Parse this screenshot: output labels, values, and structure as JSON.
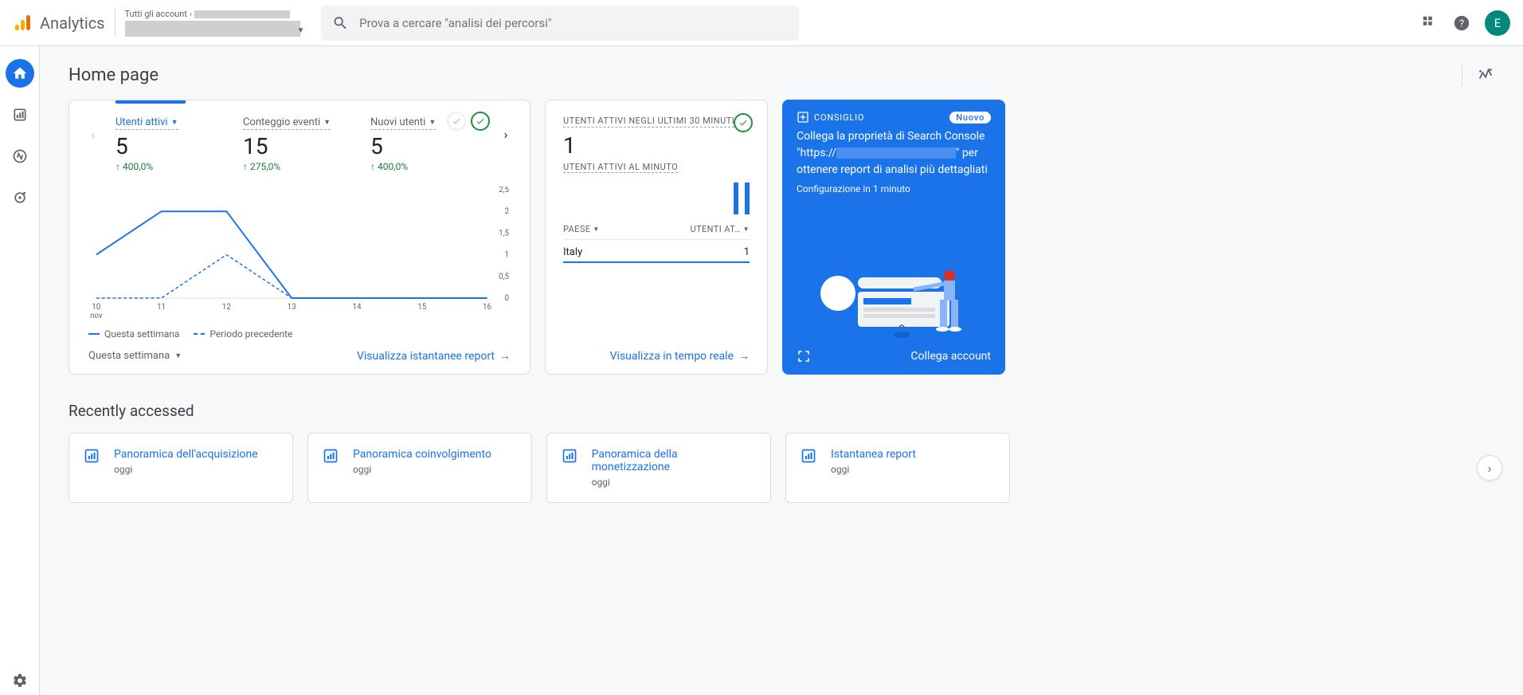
{
  "app": {
    "name": "Analytics"
  },
  "account": {
    "breadcrumb": "Tutti gli account"
  },
  "search": {
    "placeholder": "Prova a cercare \"analisi dei percorsi\""
  },
  "avatar": {
    "initial": "E"
  },
  "page": {
    "title": "Home page"
  },
  "metrics": [
    {
      "label": "Utenti attivi",
      "value": "5",
      "delta": "↑ 400,0%"
    },
    {
      "label": "Conteggio eventi",
      "value": "15",
      "delta": "↑ 275,0%"
    },
    {
      "label": "Nuovi utenti",
      "value": "5",
      "delta": "↑ 400,0%"
    }
  ],
  "chart_data": {
    "type": "line",
    "x_labels": [
      "10\nnov",
      "11",
      "12",
      "13",
      "14",
      "15",
      "16"
    ],
    "y_ticks": [
      0,
      0.5,
      1,
      1.5,
      2,
      2.5
    ],
    "ylim": [
      0,
      2.5
    ],
    "series": [
      {
        "name": "Questa settimana",
        "values": [
          1,
          2,
          2,
          0,
          0,
          0,
          0
        ]
      },
      {
        "name": "Periodo precedente",
        "values": [
          0,
          0,
          1,
          0,
          null,
          null,
          null
        ]
      }
    ]
  },
  "legend": {
    "current": "Questa settimana",
    "previous": "Periodo precedente"
  },
  "main_footer": {
    "selector": "Questa settimana",
    "link": "Visualizza istantanee report"
  },
  "realtime": {
    "title": "UTENTI ATTIVI NEGLI ULTIMI 30 MINUTI",
    "value": "1",
    "subtitle": "UTENTI ATTIVI AL MINUTO",
    "columns": {
      "country": "PAESE",
      "users": "UTENTI AT…"
    },
    "rows": [
      {
        "country": "Italy",
        "users": "1"
      }
    ],
    "link": "Visualizza in tempo reale"
  },
  "tip": {
    "label": "CONSIGLIO",
    "badge": "Nuovo",
    "body_1": "Collega la proprietà di Search Console \"https://",
    "body_2": "\" per ottenere report di analisi più dettagliati",
    "sub": "Configurazione in 1 minuto",
    "cta": "Collega account"
  },
  "recent": {
    "title": "Recently accessed",
    "items": [
      {
        "title": "Panoramica dell'acquisizione",
        "sub": "oggi"
      },
      {
        "title": "Panoramica coinvolgimento",
        "sub": "oggi"
      },
      {
        "title": "Panoramica della monetizzazione",
        "sub": "oggi"
      },
      {
        "title": "Istantanea report",
        "sub": "oggi"
      }
    ]
  }
}
